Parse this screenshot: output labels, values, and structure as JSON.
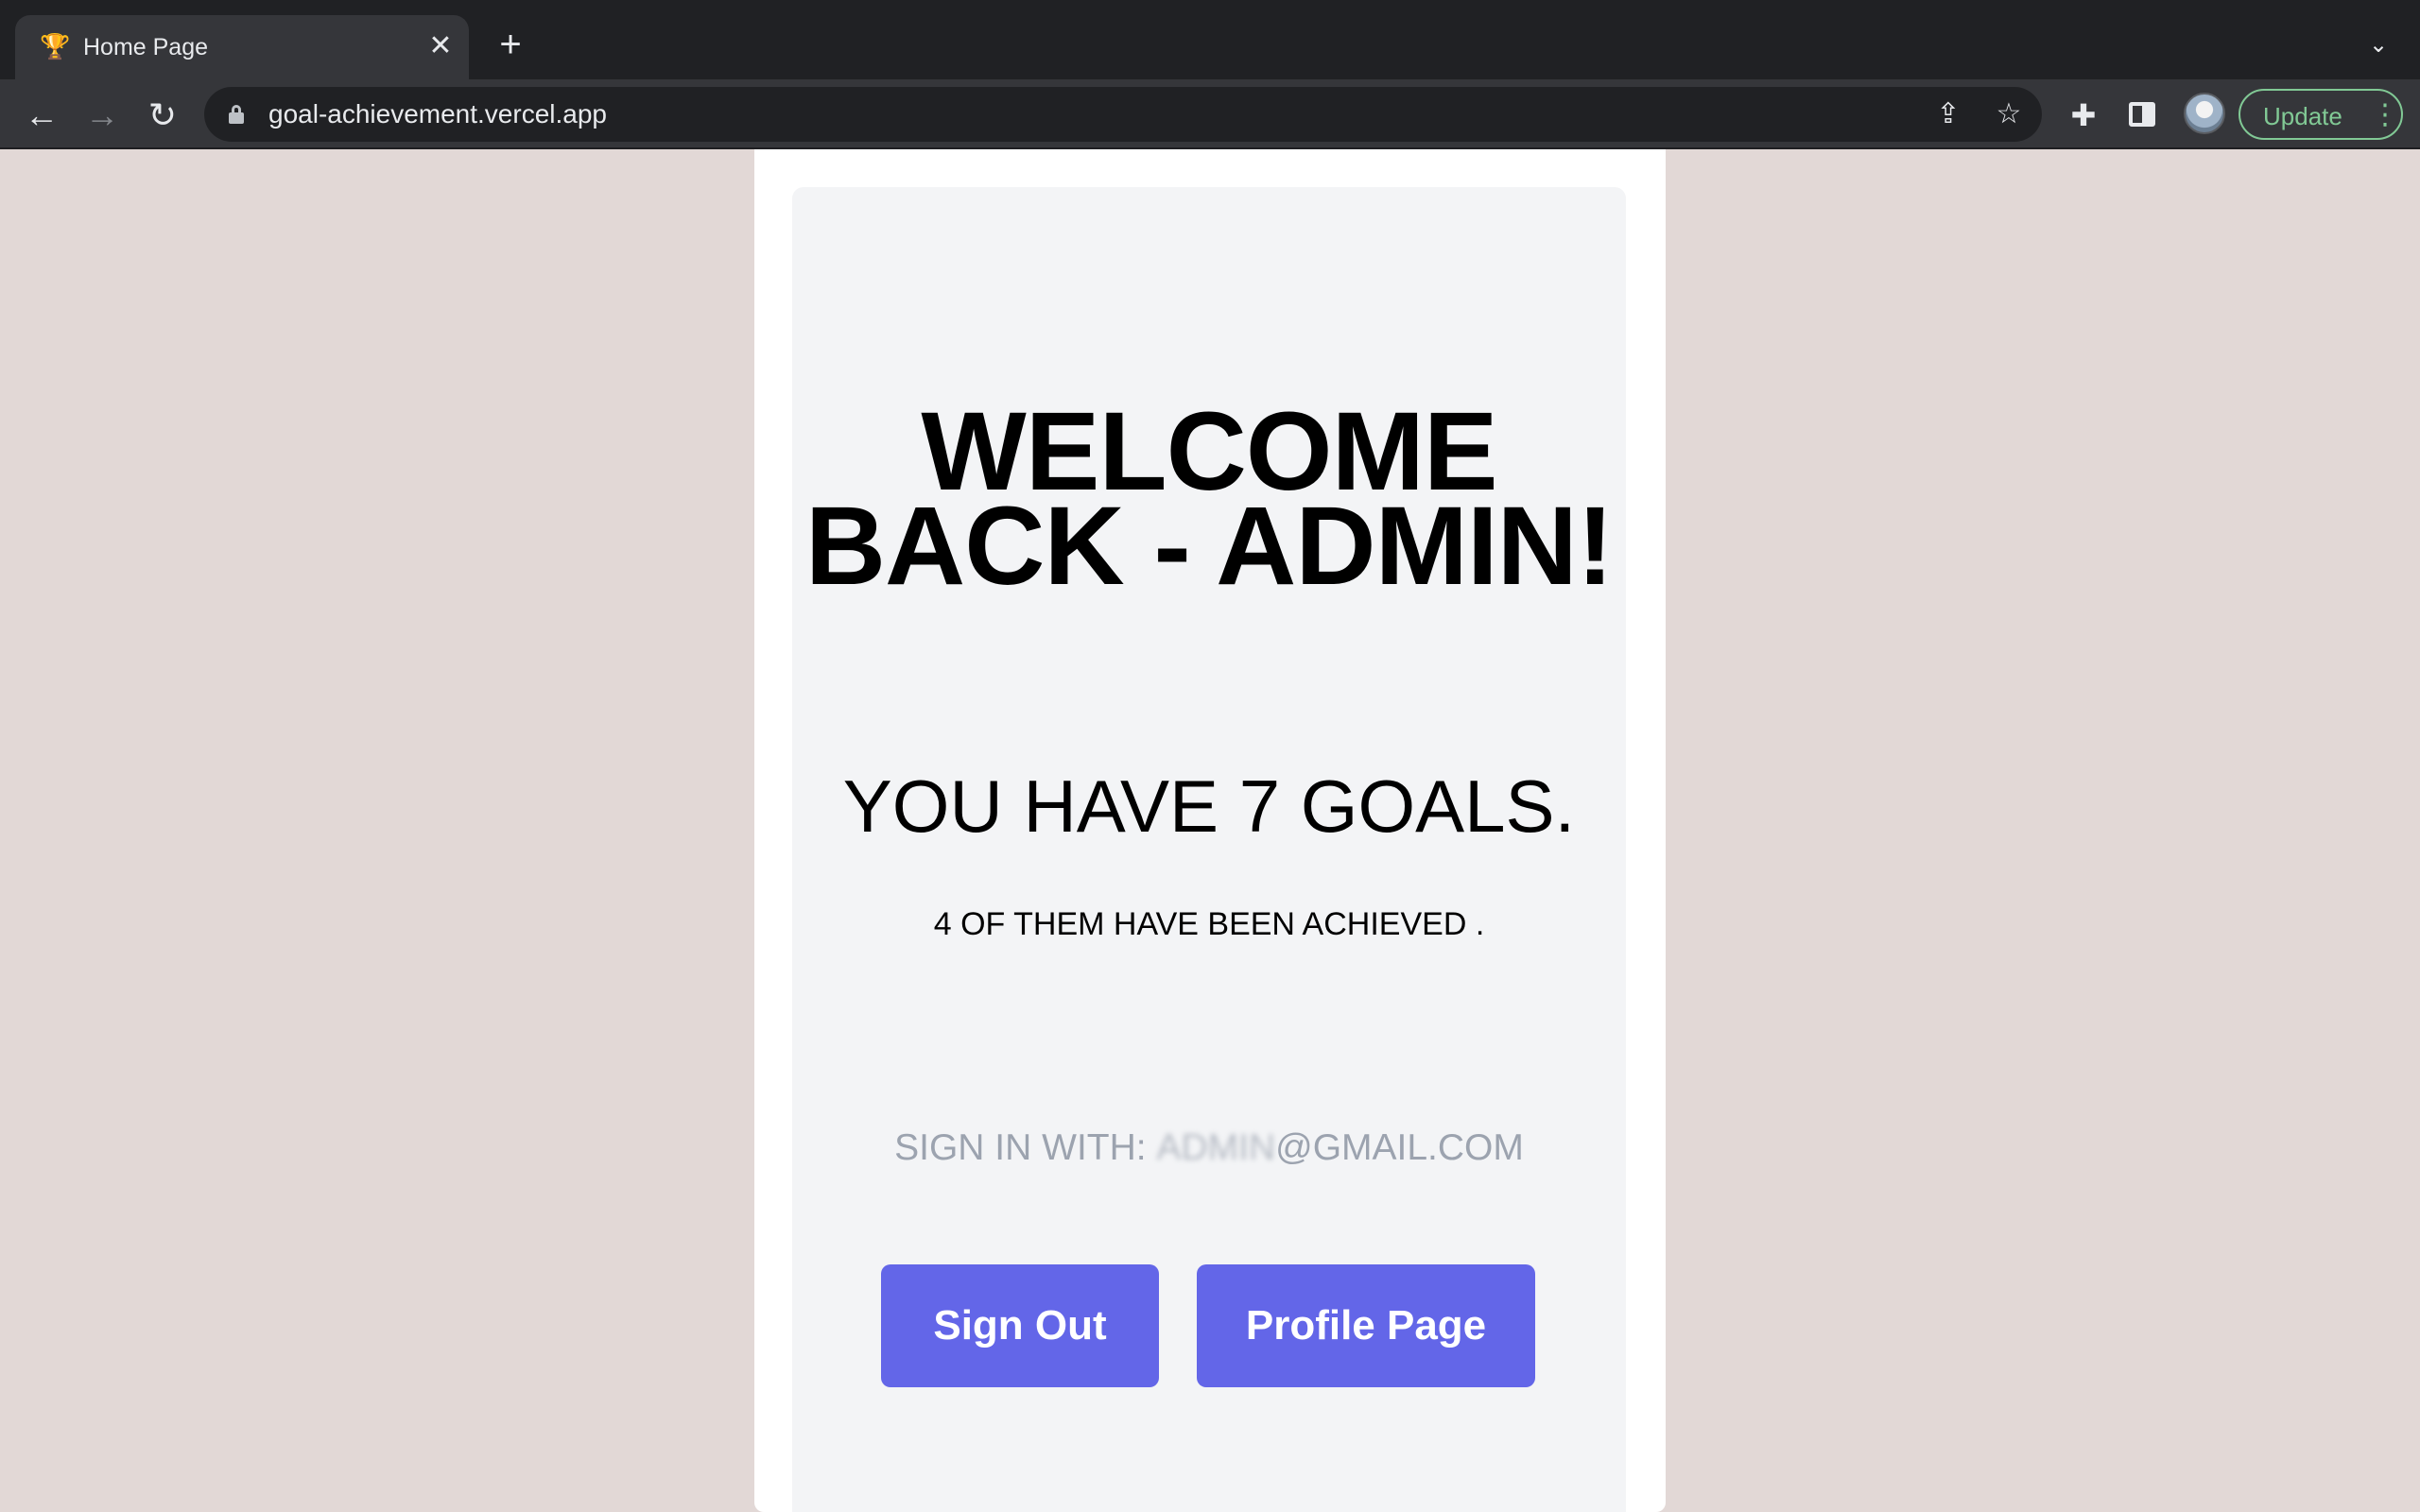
{
  "browser": {
    "tab": {
      "title": "Home Page",
      "favicon": "trophy-icon"
    },
    "url": "goal-achievement.vercel.app",
    "update_label": "Update"
  },
  "page": {
    "welcome_title": "WELCOME BACK - ADMIN!",
    "goals_text": "YOU HAVE 7 GOALS.",
    "achieved_text": "4 OF THEM HAVE BEEN ACHIEVED .",
    "signin_prefix": "SIGN IN WITH: ",
    "signin_email_local": "ADMIN",
    "signin_email_domain": "@GMAIL.COM",
    "buttons": {
      "sign_out": "Sign Out",
      "profile": "Profile Page"
    },
    "colors": {
      "background": "#e2d8d6",
      "card_inner": "#f3f4f6",
      "button": "#6366e8",
      "signin_text": "#9ca3af"
    }
  }
}
